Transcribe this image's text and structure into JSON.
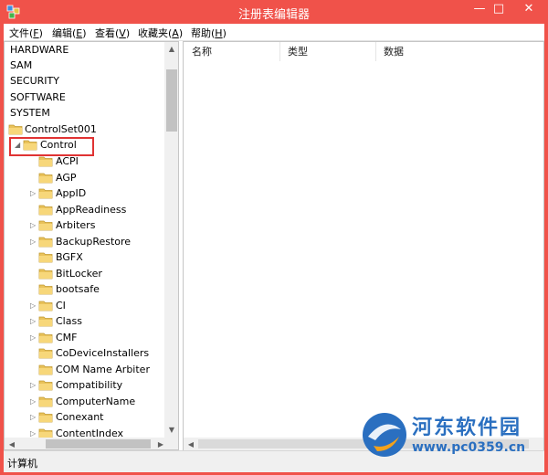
{
  "window": {
    "title": "注册表编辑器",
    "accent": "#f0524a"
  },
  "caption": {
    "minimize": "—",
    "maximize": "□",
    "close": "✕"
  },
  "menu": [
    {
      "text": "文件(",
      "key": "F",
      "end": ")"
    },
    {
      "text": "编辑(",
      "key": "E",
      "end": ")"
    },
    {
      "text": "查看(",
      "key": "V",
      "end": ")"
    },
    {
      "text": "收藏夹(",
      "key": "A",
      "end": ")"
    },
    {
      "text": "帮助(",
      "key": "H",
      "end": ")"
    }
  ],
  "tree": {
    "top": [
      "HARDWARE",
      "SAM",
      "SECURITY",
      "SOFTWARE",
      "SYSTEM"
    ],
    "controlset": "ControlSet001",
    "control": "Control",
    "children": [
      {
        "label": "ACPI",
        "expandable": false
      },
      {
        "label": "AGP",
        "expandable": false
      },
      {
        "label": "AppID",
        "expandable": true
      },
      {
        "label": "AppReadiness",
        "expandable": false
      },
      {
        "label": "Arbiters",
        "expandable": true
      },
      {
        "label": "BackupRestore",
        "expandable": true
      },
      {
        "label": "BGFX",
        "expandable": false
      },
      {
        "label": "BitLocker",
        "expandable": false
      },
      {
        "label": "bootsafe",
        "expandable": false
      },
      {
        "label": "CI",
        "expandable": true
      },
      {
        "label": "Class",
        "expandable": true
      },
      {
        "label": "CMF",
        "expandable": true
      },
      {
        "label": "CoDeviceInstallers",
        "expandable": false
      },
      {
        "label": "COM Name Arbiter",
        "expandable": false
      },
      {
        "label": "Compatibility",
        "expandable": true
      },
      {
        "label": "ComputerName",
        "expandable": true
      },
      {
        "label": "Conexant",
        "expandable": true
      },
      {
        "label": "ContentIndex",
        "expandable": true
      }
    ]
  },
  "list": {
    "columns": [
      "名称",
      "类型",
      "数据"
    ]
  },
  "status": {
    "path": "计算机"
  },
  "watermark": {
    "title": "河东软件园",
    "url": "www.pc0359.cn"
  }
}
